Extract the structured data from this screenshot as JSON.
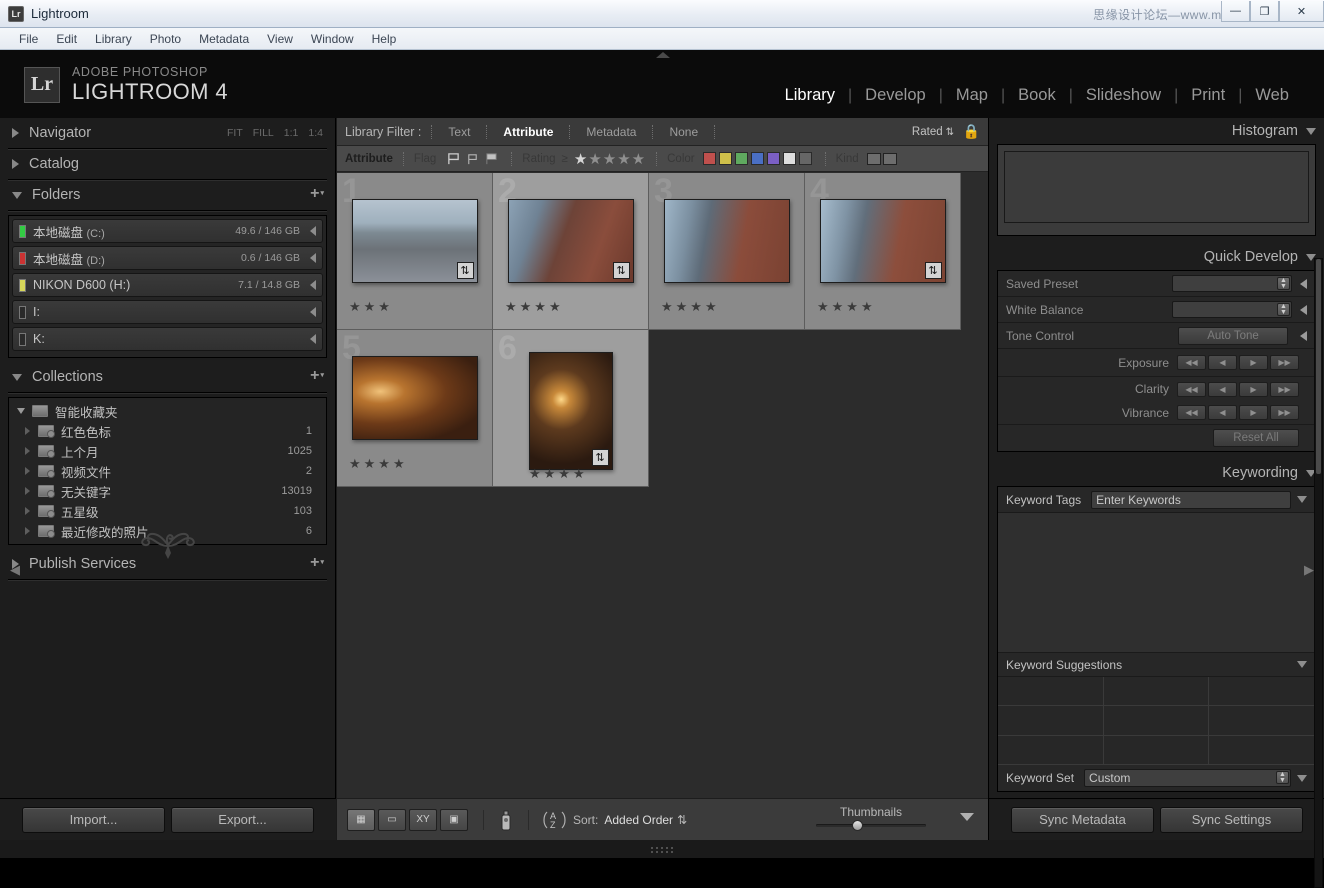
{
  "window": {
    "title": "Lightroom",
    "app_icon": "Lr",
    "watermark": "思缘设计论坛—www.missyuan.com",
    "buttons": {
      "minimize": "—",
      "maximize": "❐",
      "close": "✕"
    }
  },
  "menubar": {
    "items": [
      "File",
      "Edit",
      "Library",
      "Photo",
      "Metadata",
      "View",
      "Window",
      "Help"
    ]
  },
  "header": {
    "badge": "Lr",
    "brand_line1": "ADOBE PHOTOSHOP",
    "brand_line2": "LIGHTROOM 4",
    "modules": [
      {
        "label": "Library",
        "active": true
      },
      {
        "label": "Develop",
        "active": false
      },
      {
        "label": "Map",
        "active": false
      },
      {
        "label": "Book",
        "active": false
      },
      {
        "label": "Slideshow",
        "active": false
      },
      {
        "label": "Print",
        "active": false
      },
      {
        "label": "Web",
        "active": false
      }
    ]
  },
  "left_panel": {
    "navigator": {
      "title": "Navigator",
      "zoom_levels": [
        "FIT",
        "FILL",
        "1:1",
        "1:4"
      ]
    },
    "catalog": {
      "title": "Catalog"
    },
    "folders": {
      "title": "Folders",
      "add_label": "+",
      "volumes": [
        {
          "name": "本地磁盘",
          "drive": "(C:)",
          "size": "49.6 / 146 GB",
          "led": "#33cc44"
        },
        {
          "name": "本地磁盘",
          "drive": "(D:)",
          "size": "0.6 / 146 GB",
          "led": "#cc3333"
        },
        {
          "name": "NIKON D600 (H:)",
          "drive": "",
          "size": "7.1 / 14.8 GB",
          "led": "#d7d75a"
        },
        {
          "name": "I:",
          "drive": "",
          "size": "",
          "led": "#2a2a2a"
        },
        {
          "name": "K:",
          "drive": "",
          "size": "",
          "led": "#2a2a2a"
        }
      ]
    },
    "collections": {
      "title": "Collections",
      "add_label": "+",
      "root": "智能收藏夹",
      "items": [
        {
          "label": "红色色标",
          "count": "1"
        },
        {
          "label": "上个月",
          "count": "1025"
        },
        {
          "label": "视频文件",
          "count": "2"
        },
        {
          "label": "无关键字",
          "count": "13019"
        },
        {
          "label": "五星级",
          "count": "103"
        },
        {
          "label": "最近修改的照片",
          "count": "6"
        }
      ]
    },
    "publish_services": {
      "title": "Publish Services",
      "add_label": "+"
    },
    "buttons": {
      "import": "Import...",
      "export": "Export..."
    }
  },
  "filter": {
    "label": "Library Filter :",
    "tabs": [
      {
        "label": "Text",
        "active": false
      },
      {
        "label": "Attribute",
        "active": true
      },
      {
        "label": "Metadata",
        "active": false
      },
      {
        "label": "None",
        "active": false
      }
    ],
    "rated": "Rated",
    "lock_icon": "lock-icon"
  },
  "attribute_bar": {
    "title": "Attribute",
    "flag_label": "Flag",
    "rating_label": "Rating",
    "rating_operator": "≥",
    "rating_filled": 1,
    "rating_total": 5,
    "color_label": "Color",
    "colors": [
      "#c0504d",
      "#cfc04a",
      "#5fa95f",
      "#4a6fc4",
      "#7b5fc4",
      "#dedede",
      "#666666"
    ],
    "kind_label": "Kind"
  },
  "grid": {
    "photos": [
      {
        "index": "1",
        "rating": 3,
        "orientation": "landscape",
        "badge": true,
        "selected": false,
        "alt": "man with tripod on wet street"
      },
      {
        "index": "2",
        "rating": 4,
        "orientation": "landscape",
        "badge": true,
        "selected": true,
        "alt": "man holding camera by brick wall"
      },
      {
        "index": "3",
        "rating": 4,
        "orientation": "landscape",
        "badge": false,
        "selected": false,
        "alt": "man leaning against brick wall arms crossed"
      },
      {
        "index": "4",
        "rating": 4,
        "orientation": "landscape",
        "badge": true,
        "selected": false,
        "alt": "man leaning against brick wall wide"
      },
      {
        "index": "5",
        "rating": 4,
        "orientation": "landscape",
        "badge": false,
        "selected": false,
        "alt": "man seated at warm lit night cafe"
      },
      {
        "index": "6",
        "rating": 4,
        "orientation": "portrait",
        "badge": true,
        "selected": true,
        "alt": "man by street lamp in night alley"
      }
    ]
  },
  "toolbar": {
    "views": [
      {
        "name": "grid-view",
        "glyph": "▦",
        "active": true
      },
      {
        "name": "loupe-view",
        "glyph": "▭",
        "active": false
      },
      {
        "name": "compare-view",
        "glyph": "XY",
        "active": false
      },
      {
        "name": "survey-view",
        "glyph": "▣",
        "active": false
      }
    ],
    "spray_icon": "spray-can-icon",
    "sort_icon": "az-sort-icon",
    "sort_label": "Sort:",
    "sort_value": "Added Order",
    "thumbnails_label": "Thumbnails",
    "thumbnail_size_pct": 33
  },
  "right_panel": {
    "histogram": {
      "title": "Histogram"
    },
    "quick_develop": {
      "title": "Quick Develop",
      "saved_preset_label": "Saved Preset",
      "saved_preset_value": "",
      "white_balance_label": "White Balance",
      "white_balance_value": "",
      "tone_control_label": "Tone Control",
      "auto_tone_label": "Auto Tone",
      "exposure_label": "Exposure",
      "clarity_label": "Clarity",
      "vibrance_label": "Vibrance",
      "reset_label": "Reset All",
      "arrow_glyphs": [
        "◀◀",
        "◀",
        "▶",
        "▶▶"
      ]
    },
    "keywording": {
      "title": "Keywording",
      "keyword_tags_label": "Keyword Tags",
      "keyword_placeholder": "Enter Keywords",
      "keyword_value": "Enter Keywords",
      "suggestions_label": "Keyword Suggestions",
      "keyword_set_label": "Keyword Set",
      "keyword_set_value": "Custom"
    },
    "buttons": {
      "sync_metadata": "Sync Metadata",
      "sync_settings": "Sync Settings"
    }
  }
}
